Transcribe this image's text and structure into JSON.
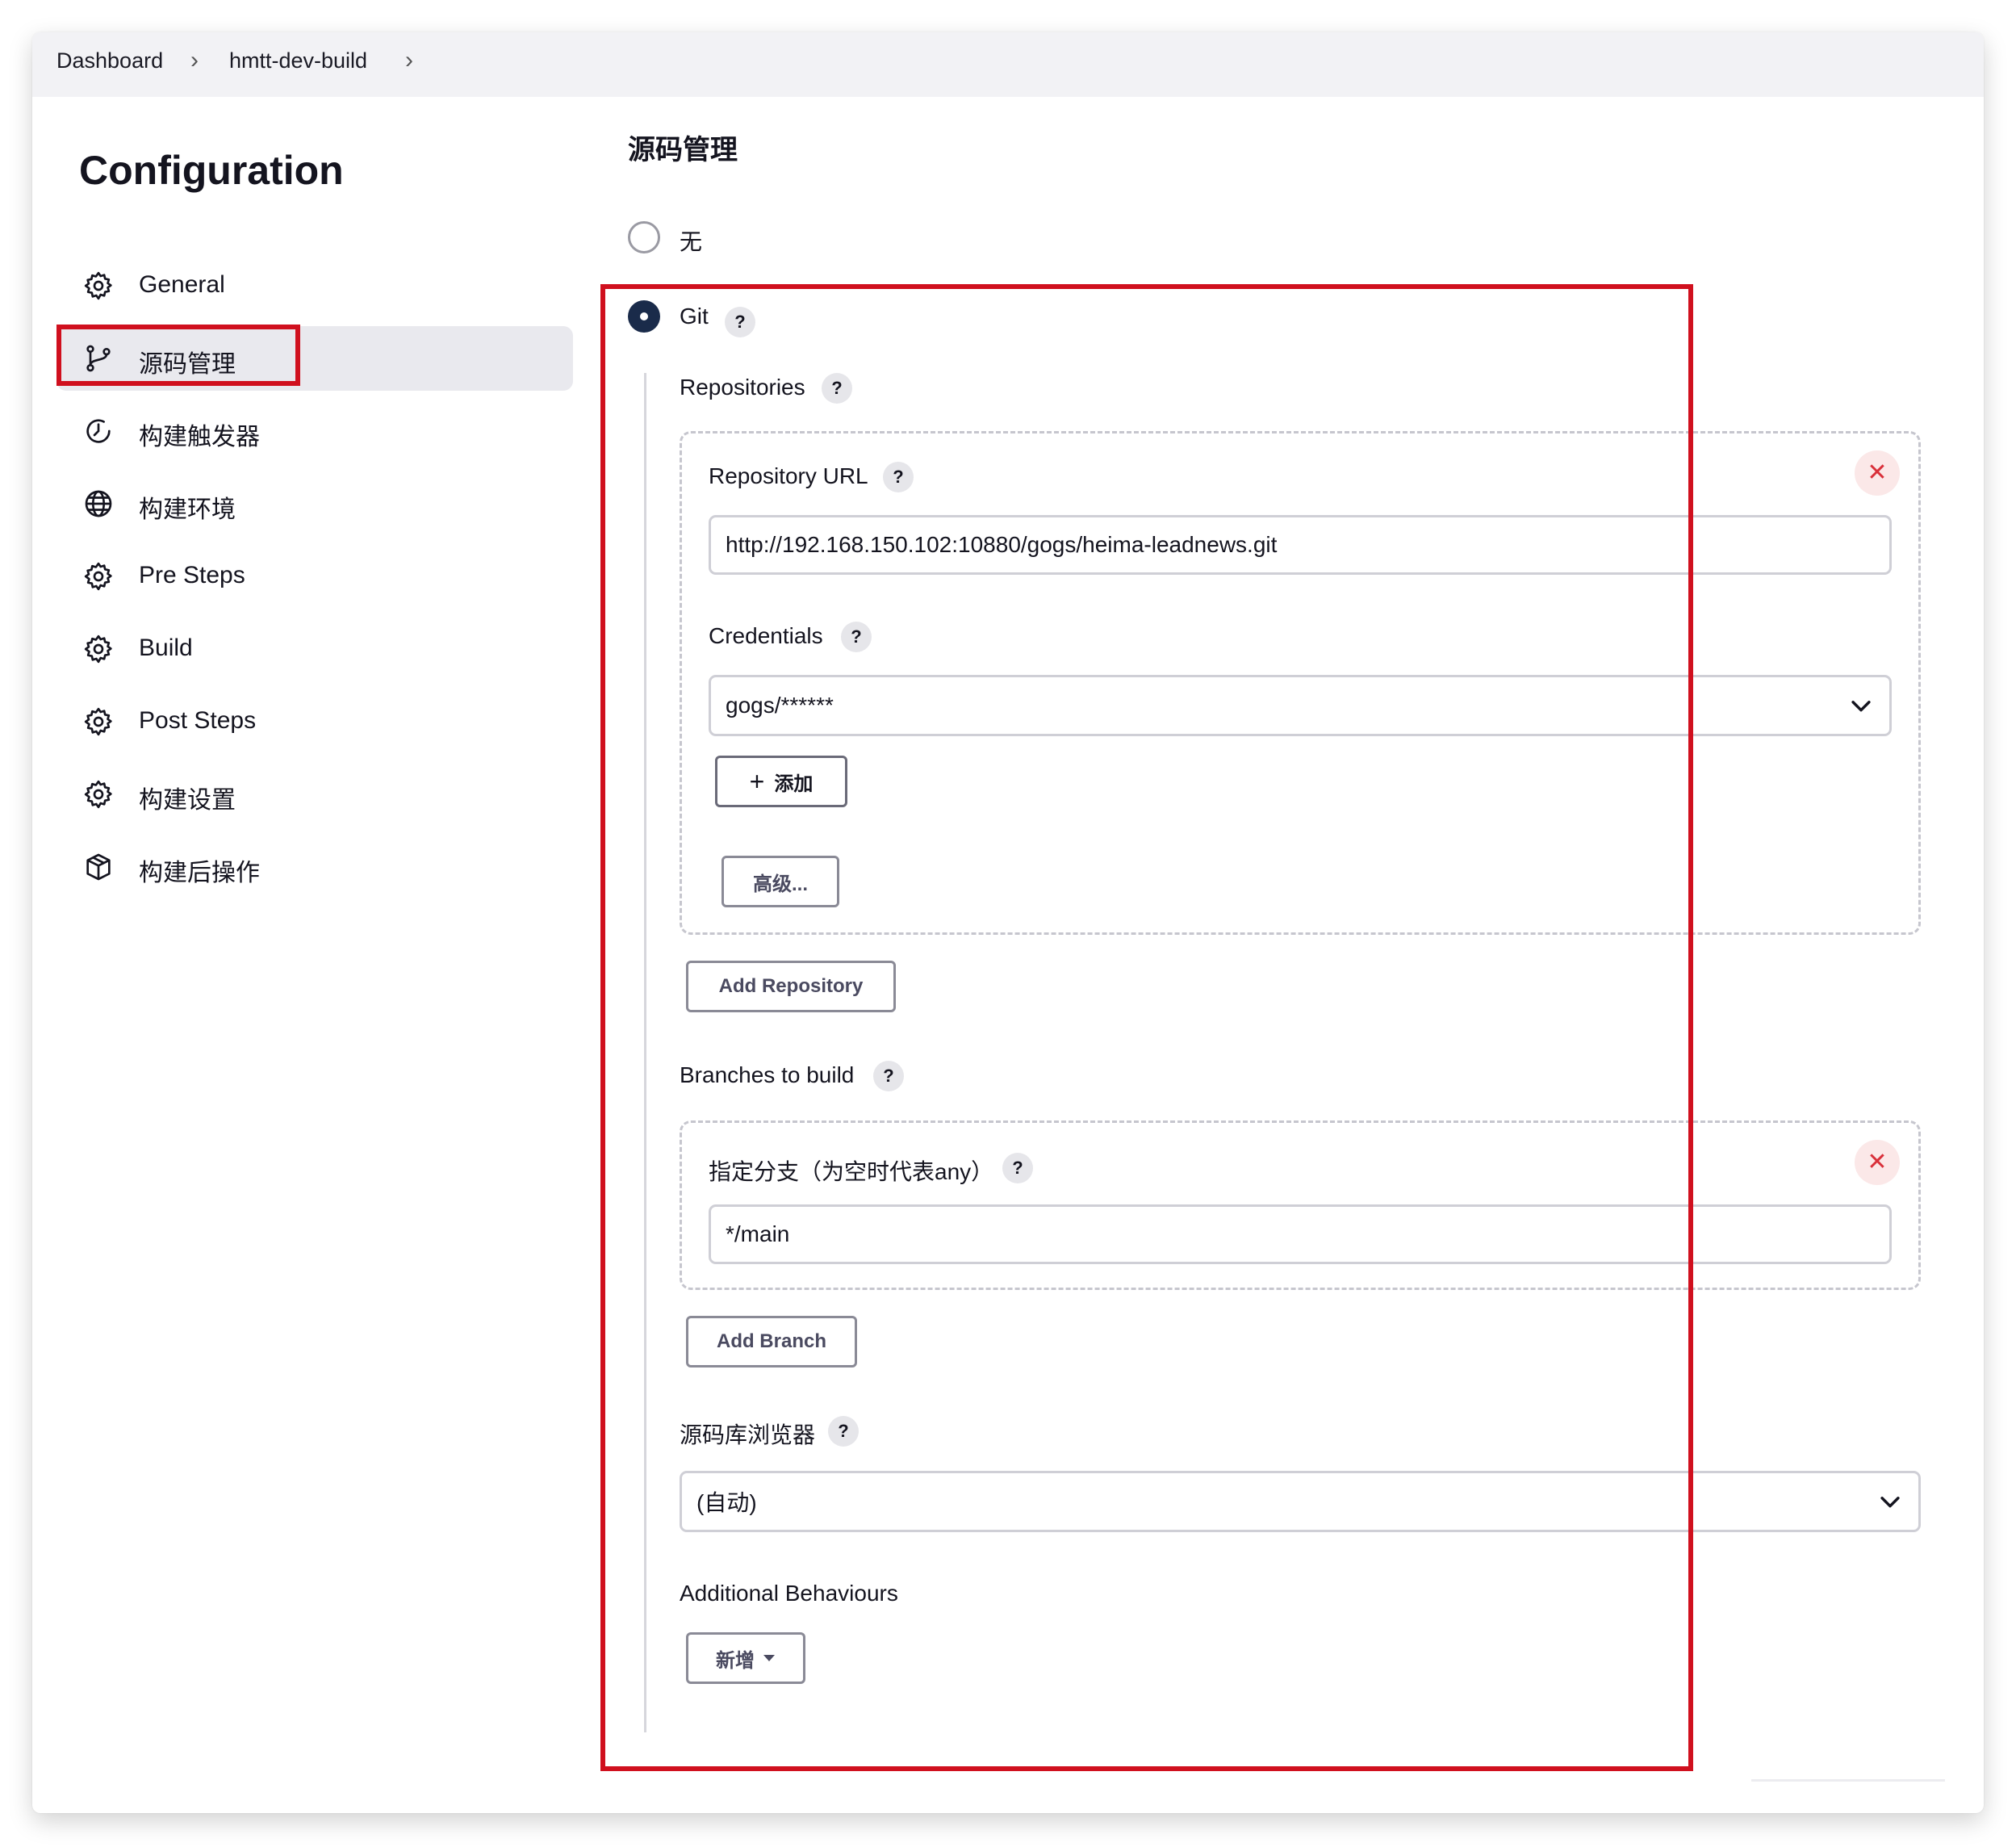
{
  "breadcrumb": {
    "items": [
      "Dashboard",
      "hmtt-dev-build"
    ],
    "separator": ">"
  },
  "page": {
    "title": "Configuration"
  },
  "sidebar": {
    "items": [
      {
        "label": "General",
        "icon": "gear-icon"
      },
      {
        "label": "源码管理",
        "icon": "branch-icon",
        "active": true
      },
      {
        "label": "构建触发器",
        "icon": "clock-icon"
      },
      {
        "label": "构建环境",
        "icon": "globe-icon"
      },
      {
        "label": "Pre Steps",
        "icon": "gear-icon"
      },
      {
        "label": "Build",
        "icon": "gear-icon"
      },
      {
        "label": "Post Steps",
        "icon": "gear-icon"
      },
      {
        "label": "构建设置",
        "icon": "gear-icon"
      },
      {
        "label": "构建后操作",
        "icon": "package-icon"
      }
    ]
  },
  "scm": {
    "title": "源码管理",
    "option_none": "无",
    "option_git": "Git",
    "help": "?",
    "repositories_label": "Repositories",
    "repo_url_label": "Repository URL",
    "repo_url_value": "http://192.168.150.102:10880/gogs/heima-leadnews.git",
    "credentials_label": "Credentials",
    "credentials_value": "gogs/******",
    "add_credentials_label": "添加",
    "advanced_label": "高级...",
    "add_repository_label": "Add Repository",
    "branches_label": "Branches to build",
    "branch_specifier_label": "指定分支（为空时代表any）",
    "branch_value": "*/main",
    "add_branch_label": "Add Branch",
    "repo_browser_label": "源码库浏览器",
    "repo_browser_value": "(自动)",
    "additional_behaviours_label": "Additional Behaviours",
    "add_behaviour_label": "新增",
    "close_symbol": "✕"
  },
  "colors": {
    "highlight": "#d0101e",
    "radio_selected": "#1a2b4a",
    "active_nav_bg": "#e9e9ee",
    "close_button": "#d9303a"
  }
}
